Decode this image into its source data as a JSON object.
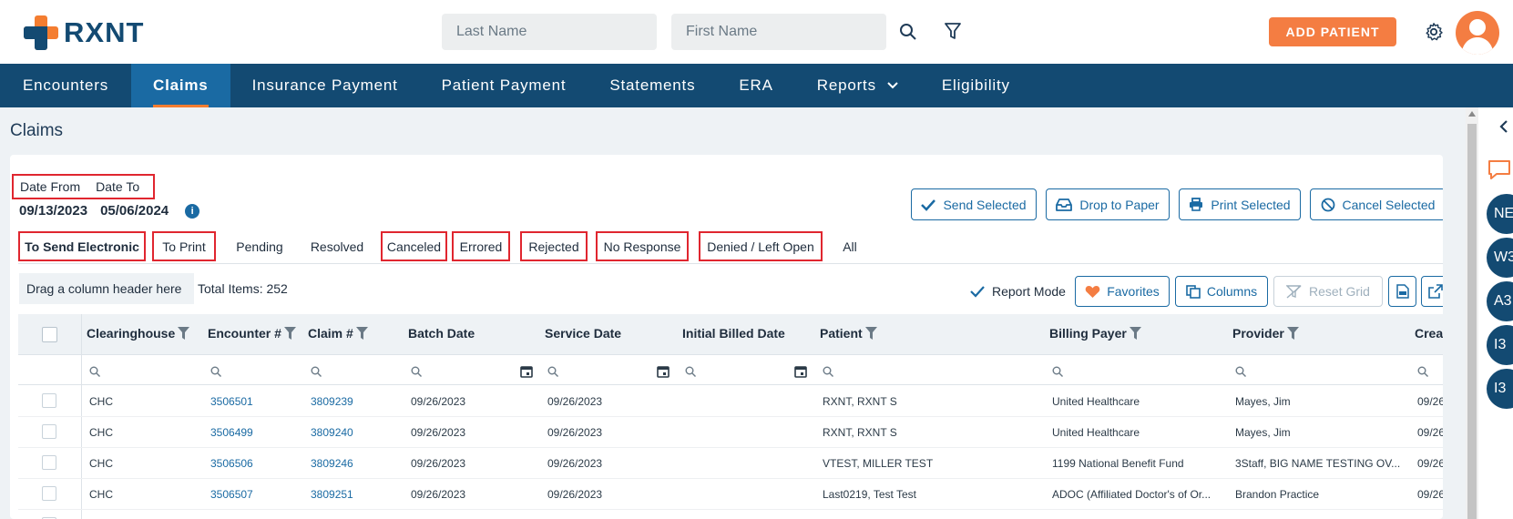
{
  "header": {
    "logo_text": "RXNT",
    "last_name_placeholder": "Last Name",
    "first_name_placeholder": "First Name",
    "add_patient_label": "ADD PATIENT",
    "accent_color": "#f47d42",
    "brand_color": "#134a72"
  },
  "nav": {
    "items": [
      {
        "label": "Encounters"
      },
      {
        "label": "Claims",
        "active": true
      },
      {
        "label": "Insurance Payment"
      },
      {
        "label": "Patient Payment"
      },
      {
        "label": "Statements"
      },
      {
        "label": "ERA"
      },
      {
        "label": "Reports"
      },
      {
        "label": "Eligibility"
      }
    ]
  },
  "page": {
    "title": "Claims",
    "date_from_label": "Date From",
    "date_to_label": "Date To",
    "date_from_value": "09/13/2023",
    "date_to_value": "05/06/2024"
  },
  "actions": {
    "send_selected": "Send Selected",
    "drop_to_paper": "Drop to Paper",
    "print_selected": "Print Selected",
    "cancel_selected": "Cancel Selected"
  },
  "tabs": [
    {
      "label": "To Send Electronic",
      "active": true
    },
    {
      "label": "To Print"
    },
    {
      "label": "Pending"
    },
    {
      "label": "Resolved"
    },
    {
      "label": "Canceled"
    },
    {
      "label": "Errored"
    },
    {
      "label": "Rejected"
    },
    {
      "label": "No Response"
    },
    {
      "label": "Denied / Left Open"
    },
    {
      "label": "All"
    }
  ],
  "toolbar": {
    "drag_hint": "Drag a column header here",
    "total_items": "Total Items: 252",
    "report_mode_label": "Report Mode",
    "favorites_label": "Favorites",
    "columns_label": "Columns",
    "reset_grid_label": "Reset Grid"
  },
  "grid": {
    "columns": [
      "Clearinghouse",
      "Encounter #",
      "Claim #",
      "Batch Date",
      "Service Date",
      "Initial Billed Date",
      "Patient",
      "Billing Payer",
      "Provider",
      "Crea"
    ],
    "rows": [
      [
        "CHC",
        "3506501",
        "3809239",
        "09/26/2023",
        "09/26/2023",
        "",
        "RXNT, RXNT S",
        "United Healthcare",
        "Mayes, Jim",
        "09/26"
      ],
      [
        "CHC",
        "3506499",
        "3809240",
        "09/26/2023",
        "09/26/2023",
        "",
        "RXNT, RXNT S",
        "United Healthcare",
        "Mayes, Jim",
        "09/26"
      ],
      [
        "CHC",
        "3506506",
        "3809246",
        "09/26/2023",
        "09/26/2023",
        "",
        "VTEST, MILLER TEST",
        "1199 National Benefit Fund",
        "3Staff, BIG NAME TESTING OV...",
        "09/26"
      ],
      [
        "CHC",
        "3506507",
        "3809251",
        "09/26/2023",
        "09/26/2023",
        "",
        "Last0219, Test Test",
        "ADOC (Affiliated Doctor's of Or...",
        "Brandon Practice",
        "09/26"
      ]
    ]
  },
  "right_strip": {
    "tags": [
      "NE",
      "W3",
      "A3",
      "I3",
      "I3"
    ]
  }
}
